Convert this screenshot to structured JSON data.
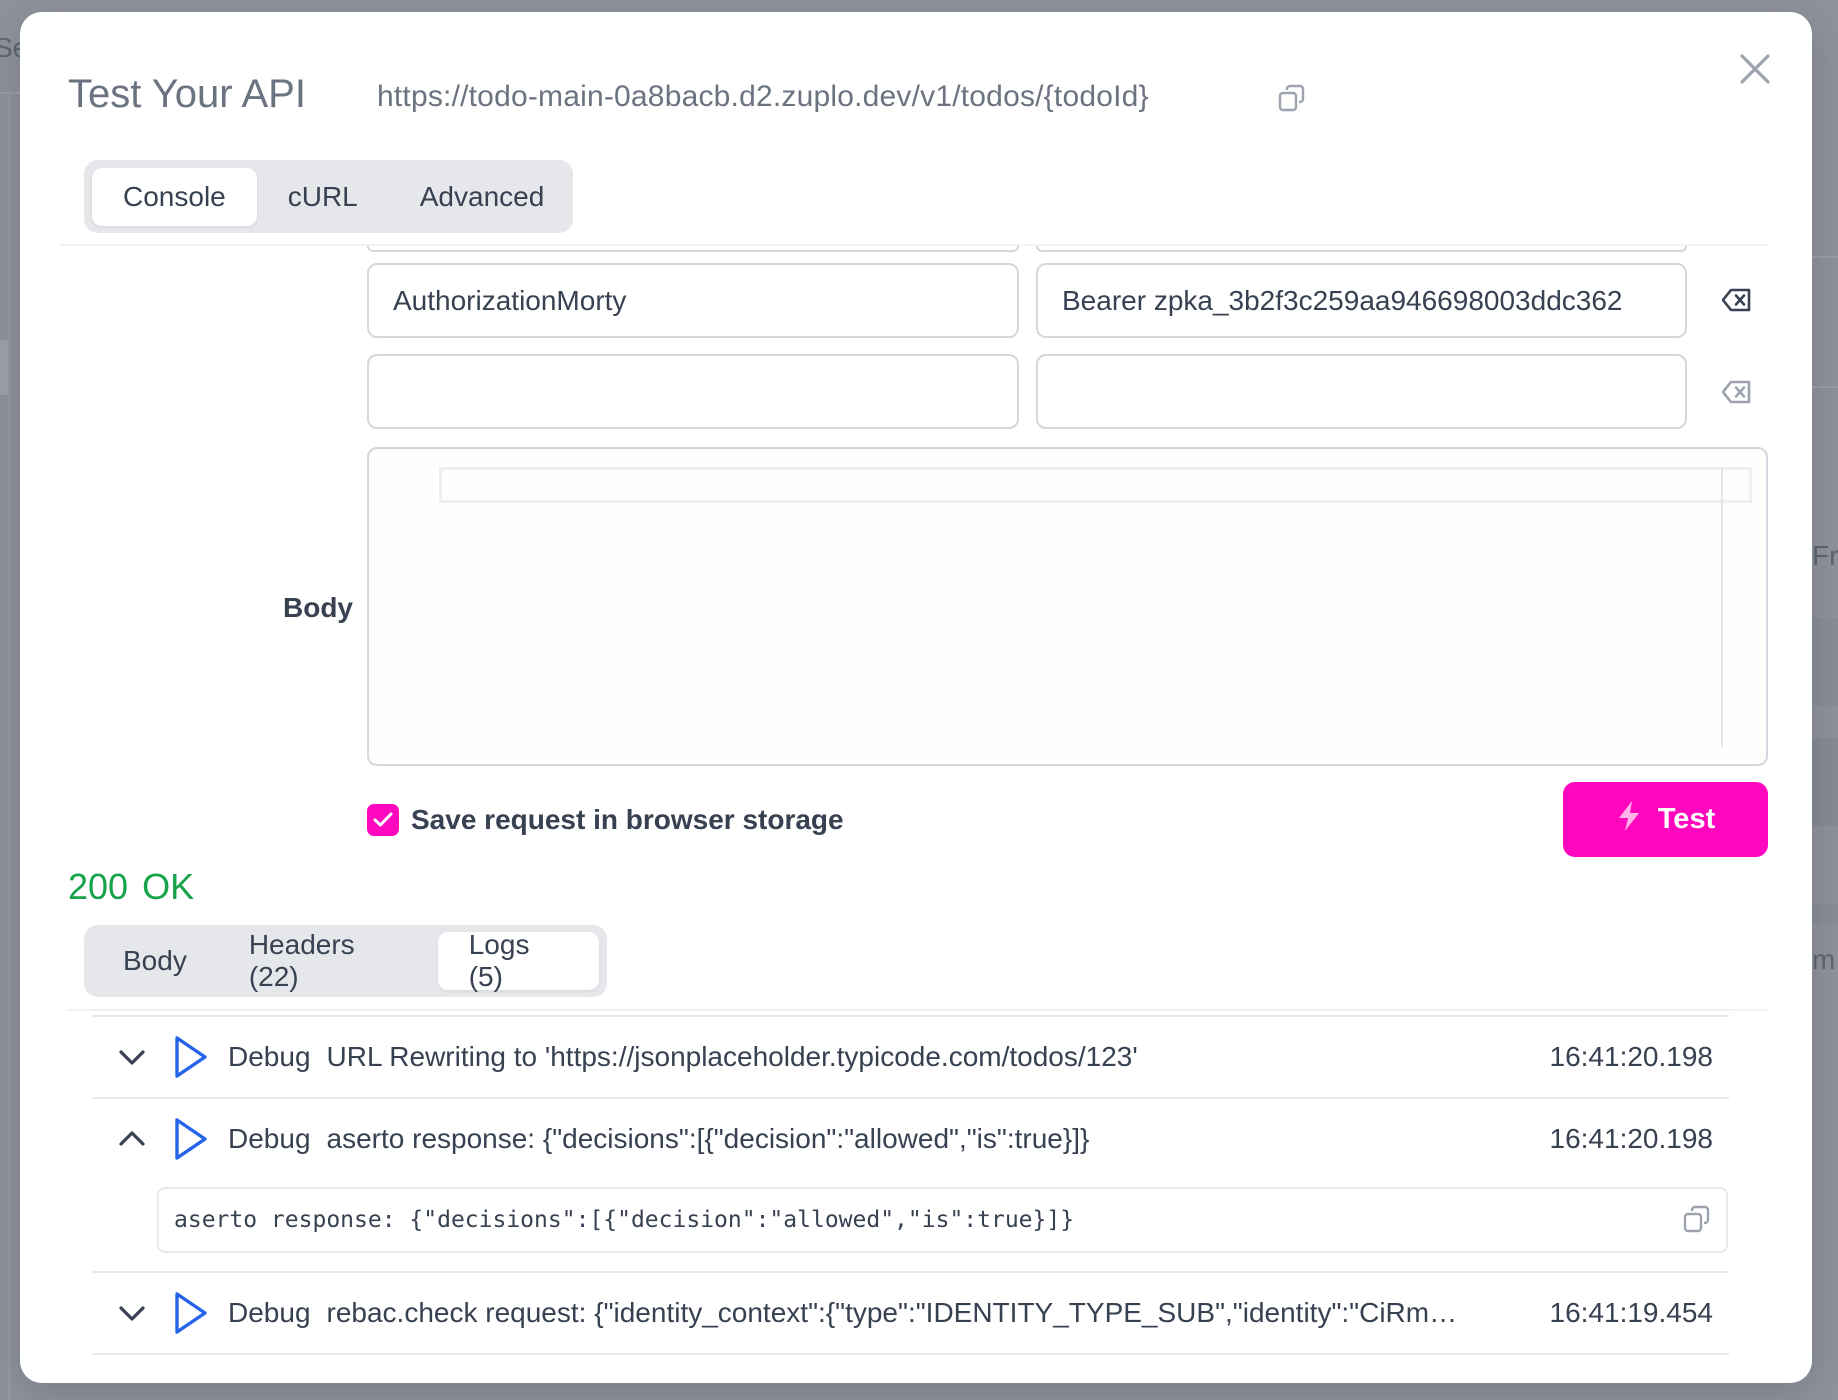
{
  "background": {
    "partial_texts": [
      "Se",
      "Fr",
      "m"
    ]
  },
  "dialog": {
    "title": "Test Your API",
    "url": "https://todo-main-0a8bacb.d2.zuplo.dev/v1/todos/{todoId}",
    "icons": {
      "copy_url": "copy-icon",
      "close": "close-icon"
    }
  },
  "request_tabs": [
    {
      "label": "Console",
      "active": true
    },
    {
      "label": "cURL",
      "active": false
    },
    {
      "label": "Advanced",
      "active": false
    }
  ],
  "headers": {
    "rows": [
      {
        "name": "AuthorizationMorty",
        "value": "Bearer zpka_3b2f3c259aa946698003ddc362",
        "name_placeholder": "",
        "value_placeholder": ""
      },
      {
        "name": "",
        "value": "",
        "name_placeholder": "",
        "value_placeholder": ""
      }
    ],
    "delete_icon": "backspace-delete-icon"
  },
  "body_section": {
    "label": "Body",
    "value": ""
  },
  "save_request": {
    "label": "Save request in browser storage",
    "checked": true
  },
  "test_button": {
    "label": "Test",
    "icon": "lightning-bolt-icon",
    "color": "#ff07bf"
  },
  "response": {
    "status_code": "200",
    "status_text": "OK",
    "status_color": "#16a34a",
    "tabs": [
      {
        "label": "Body",
        "active": false
      },
      {
        "label": "Headers (22)",
        "active": false
      },
      {
        "label": "Logs (5)",
        "active": true
      }
    ],
    "logs": [
      {
        "level": "Debug",
        "message": "URL Rewriting to 'https://jsonplaceholder.typicode.com/todos/123'",
        "timestamp": "16:41:20.198",
        "expanded": false
      },
      {
        "level": "Debug",
        "message": "aserto response: {\"decisions\":[{\"decision\":\"allowed\",\"is\":true}]}",
        "timestamp": "16:41:20.198",
        "expanded": true,
        "detail": "aserto response: {\"decisions\":[{\"decision\":\"allowed\",\"is\":true}]}"
      },
      {
        "level": "Debug",
        "message": "rebac.check request: {\"identity_context\":{\"type\":\"IDENTITY_TYPE_SUB\",\"identity\":\"CiRm…",
        "timestamp": "16:41:19.454",
        "expanded": false
      }
    ]
  }
}
